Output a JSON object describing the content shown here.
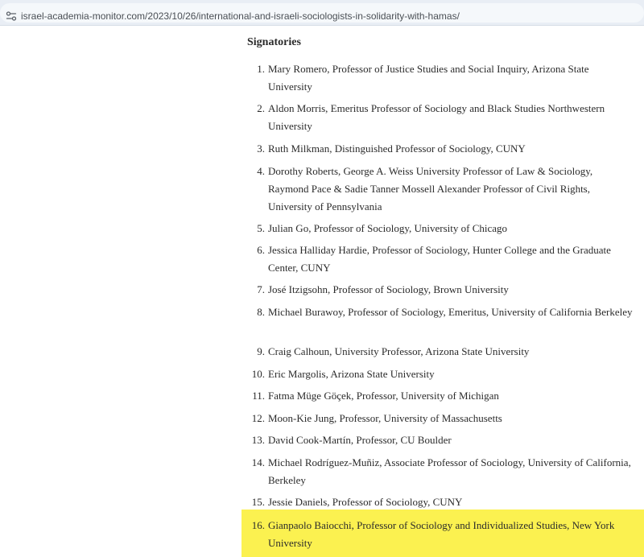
{
  "browser": {
    "url": "israel-academia-monitor.com/2023/10/26/international-and-israeli-sociologists-in-solidarity-with-hamas/"
  },
  "article": {
    "heading": "Signatories",
    "signatories": [
      {
        "number": "1.",
        "text": "Mary Romero, Professor of Justice Studies and Social Inquiry, Arizona State University"
      },
      {
        "number": "2.",
        "text": "Aldon Morris, Emeritus Professor of Sociology and Black Studies Northwestern University"
      },
      {
        "number": "3.",
        "text": "Ruth Milkman, Distinguished Professor of Sociology, CUNY"
      },
      {
        "number": "4.",
        "text": "Dorothy Roberts, George A. Weiss University Professor of Law & Sociology, Raymond Pace & Sadie Tanner Mossell Alexander Professor of Civil Rights, University of Pennsylvania"
      },
      {
        "number": "5.",
        "text": "Julian Go, Professor of Sociology, University of Chicago"
      },
      {
        "number": "6.",
        "text": "Jessica Halliday Hardie, Professor of Sociology, Hunter College and the Graduate Center, CUNY"
      },
      {
        "number": "7.",
        "text": "José Itzigsohn, Professor of Sociology, Brown University"
      },
      {
        "number": "8.",
        "text": "Michael Burawoy, Professor of Sociology, Emeritus, University of California Berkeley"
      },
      {
        "number": "9.",
        "text": "Craig Calhoun, University Professor, Arizona State University"
      },
      {
        "number": "10.",
        "text": "Eric Margolis, Arizona State University"
      },
      {
        "number": "11.",
        "text": "Fatma Müge Göçek, Professor, University of Michigan"
      },
      {
        "number": "12.",
        "text": "Moon-Kie Jung, Professor, University of Massachusetts"
      },
      {
        "number": "13.",
        "text": "David Cook-Martín, Professor, CU Boulder"
      },
      {
        "number": "14.",
        "text": "Michael Rodríguez-Muñiz, Associate Professor of Sociology, University of California, Berkeley"
      },
      {
        "number": "15.",
        "text": "Jessie Daniels, Professor of Sociology, CUNY"
      },
      {
        "number": "16.",
        "text": "Gianpaolo Baiocchi, Professor of Sociology and Individualized Studies, New York University"
      }
    ],
    "highlight_color": "#fbf150"
  }
}
